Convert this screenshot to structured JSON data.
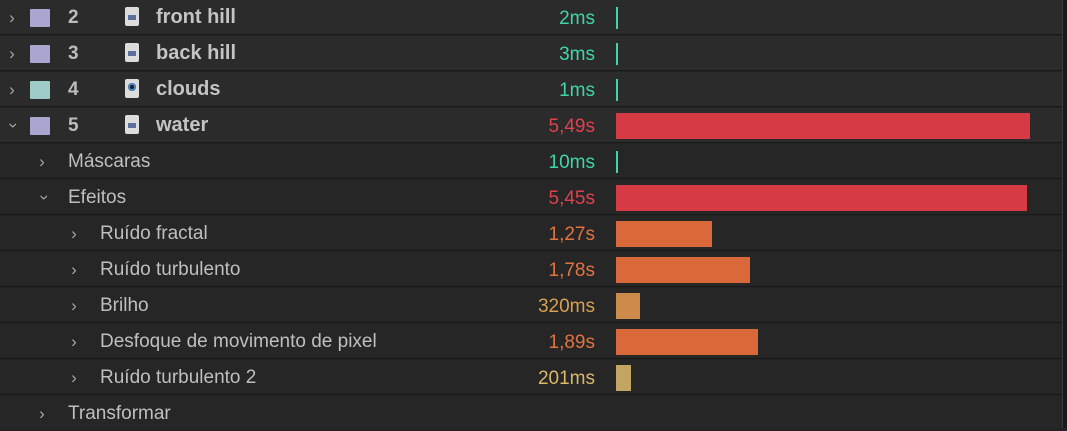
{
  "layers": [
    {
      "index": "2",
      "name": "front hill",
      "time": "2ms",
      "time_color": "#3ed6a6",
      "level": "tick",
      "swatch": "#a9a7cf",
      "icon": "image-file-icon",
      "expanded": false
    },
    {
      "index": "3",
      "name": "back hill",
      "time": "3ms",
      "time_color": "#3ed6a6",
      "level": "tick",
      "swatch": "#a9a7cf",
      "icon": "image-file-icon",
      "expanded": false
    },
    {
      "index": "4",
      "name": "clouds",
      "time": "1ms",
      "time_color": "#3ed6a6",
      "level": "tick",
      "swatch": "#9fcbc8",
      "icon": "media-file-icon",
      "expanded": false
    },
    {
      "index": "5",
      "name": "water",
      "time": "5,49s",
      "time_color": "#e0404f",
      "level": 1.0,
      "swatch": "#a9a7cf",
      "icon": "image-file-icon",
      "expanded": true
    }
  ],
  "groups": {
    "masks": {
      "label": "Máscaras",
      "time": "10ms",
      "time_color": "#3ed6a6",
      "level": "tick"
    },
    "effects": {
      "label": "Efeitos",
      "time": "5,45s",
      "time_color": "#e0404f",
      "level": 0.993
    },
    "transform": {
      "label": "Transformar"
    }
  },
  "effects": [
    {
      "name": "Ruído fractal",
      "time": "1,27s",
      "time_color": "#e0733f",
      "level": 0.231,
      "bar_color": "#d9683a"
    },
    {
      "name": "Ruído turbulento",
      "time": "1,78s",
      "time_color": "#e0733f",
      "level": 0.324,
      "bar_color": "#d9683a"
    },
    {
      "name": "Brilho",
      "time": "320ms",
      "time_color": "#d9a050",
      "level": 0.058,
      "bar_color": "#cc8b4b"
    },
    {
      "name": "Desfoque de movimento de pixel",
      "time": "1,89s",
      "time_color": "#e0733f",
      "level": 0.344,
      "bar_color": "#d9683a"
    },
    {
      "name": "Ruído turbulento 2",
      "time": "201ms",
      "time_color": "#d8b86a",
      "level": 0.037,
      "bar_color": "#c2a560"
    }
  ],
  "colors": {
    "bar_red": "#d63a45",
    "tick_green": "#3ed6a6"
  }
}
